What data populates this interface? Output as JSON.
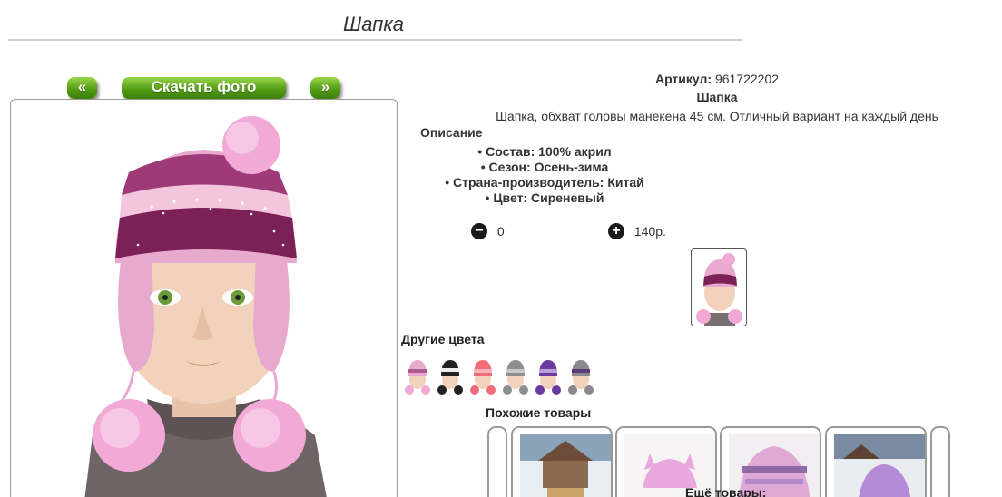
{
  "product": {
    "title": "Шапка",
    "article_label": "Артикул:",
    "article_value": "961722202",
    "name": "Шапка",
    "description": "Шапка, обхват головы манекена 45 см. Отличный вариант на каждый день",
    "description_label": "Описание",
    "specs": [
      "Состав: 100% акрил",
      "Сезон: Осень-зима",
      "Страна-производитель: Китай",
      "Цвет: Сиреневый"
    ]
  },
  "gallery": {
    "prev_label": "«",
    "download_label": "Скачать фото",
    "next_label": "»"
  },
  "cart": {
    "minus_icon": "−",
    "quantity": "0",
    "plus_icon": "+",
    "price": "140р."
  },
  "other_colors": {
    "title": "Другие цвета",
    "swatches": [
      "pink",
      "black",
      "coral",
      "grey",
      "purple",
      "grey-purple"
    ]
  },
  "similar": {
    "title": "Похожие товары"
  },
  "more": {
    "title": "Ещё товары:"
  }
}
